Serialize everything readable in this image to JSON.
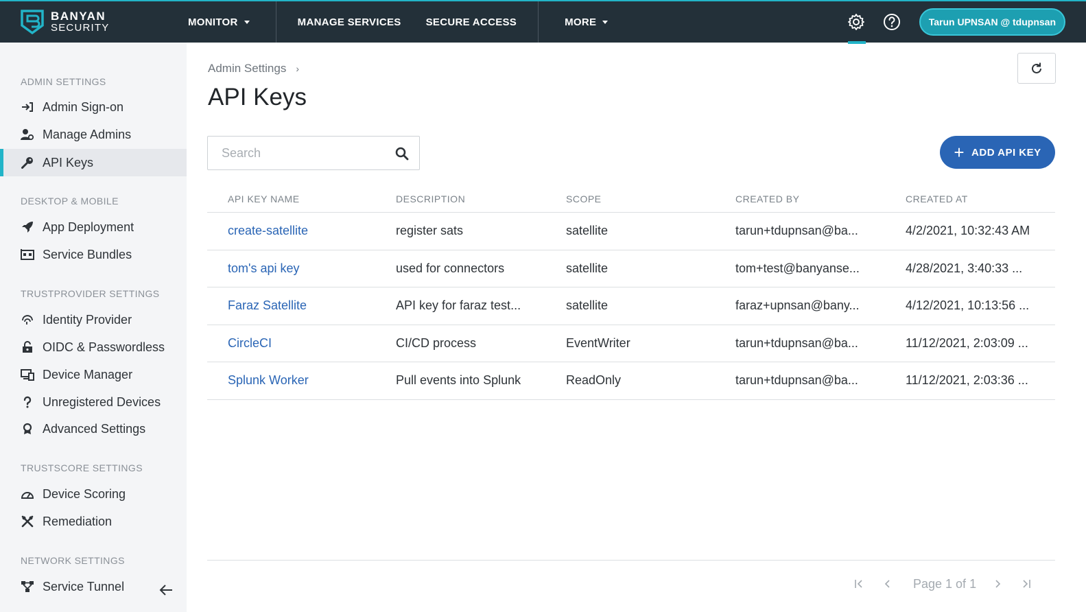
{
  "brand": {
    "line1": "BANYAN",
    "line2": "SECURITY"
  },
  "nav": {
    "monitor": "MONITOR",
    "manage_services": "MANAGE SERVICES",
    "secure_access": "SECURE ACCESS",
    "more": "MORE"
  },
  "user": {
    "label": "Tarun UPNSAN @ tdupnsan"
  },
  "colors": {
    "topbar": "#233039",
    "accent": "#22b4c8",
    "primary": "#2a65b5",
    "user_pill": "#1d9fb1"
  },
  "sidebar": {
    "sections": [
      {
        "title": "ADMIN SETTINGS",
        "items": [
          {
            "label": "Admin Sign-on",
            "icon": "sign-in-icon"
          },
          {
            "label": "Manage Admins",
            "icon": "admins-icon"
          },
          {
            "label": "API Keys",
            "icon": "key-icon",
            "active": true
          }
        ]
      },
      {
        "title": "DESKTOP & MOBILE",
        "items": [
          {
            "label": "App Deployment",
            "icon": "rocket-icon"
          },
          {
            "label": "Service Bundles",
            "icon": "bundle-icon"
          }
        ]
      },
      {
        "title": "TRUSTPROVIDER SETTINGS",
        "items": [
          {
            "label": "Identity Provider",
            "icon": "fingerprint-icon"
          },
          {
            "label": "OIDC & Passwordless",
            "icon": "lock-icon"
          },
          {
            "label": "Device Manager",
            "icon": "devices-icon"
          },
          {
            "label": "Unregistered Devices",
            "icon": "question-icon"
          },
          {
            "label": "Advanced Settings",
            "icon": "badge-icon"
          }
        ]
      },
      {
        "title": "TRUSTSCORE SETTINGS",
        "items": [
          {
            "label": "Device Scoring",
            "icon": "gauge-icon"
          },
          {
            "label": "Remediation",
            "icon": "tools-icon"
          }
        ]
      },
      {
        "title": "NETWORK SETTINGS",
        "items": [
          {
            "label": "Service Tunnel",
            "icon": "network-icon"
          }
        ]
      }
    ]
  },
  "breadcrumb": {
    "parent": "Admin Settings",
    "separator": "›"
  },
  "page": {
    "title": "API Keys"
  },
  "search": {
    "placeholder": "Search",
    "value": ""
  },
  "add_button": {
    "plus": "+",
    "label": "ADD API KEY"
  },
  "table": {
    "columns": [
      "API KEY NAME",
      "DESCRIPTION",
      "SCOPE",
      "CREATED BY",
      "CREATED AT"
    ],
    "rows": [
      [
        "create-satellite",
        "register sats",
        "satellite",
        "tarun+tdupnsan@ba...",
        "4/2/2021, 10:32:43 AM"
      ],
      [
        "tom's api key",
        "used for connectors",
        "satellite",
        "tom+test@banyanse...",
        "4/28/2021, 3:40:33 ..."
      ],
      [
        "Faraz Satellite",
        "API key for faraz test...",
        "satellite",
        "faraz+upnsan@bany...",
        "4/12/2021, 10:13:56 ..."
      ],
      [
        "CircleCI",
        "CI/CD process",
        "EventWriter",
        "tarun+tdupnsan@ba...",
        "11/12/2021, 2:03:09 ..."
      ],
      [
        "Splunk Worker",
        "Pull events into Splunk",
        "ReadOnly",
        "tarun+tdupnsan@ba...",
        "11/12/2021, 2:03:36 ..."
      ]
    ]
  },
  "pagination": {
    "text": "Page 1 of 1"
  }
}
